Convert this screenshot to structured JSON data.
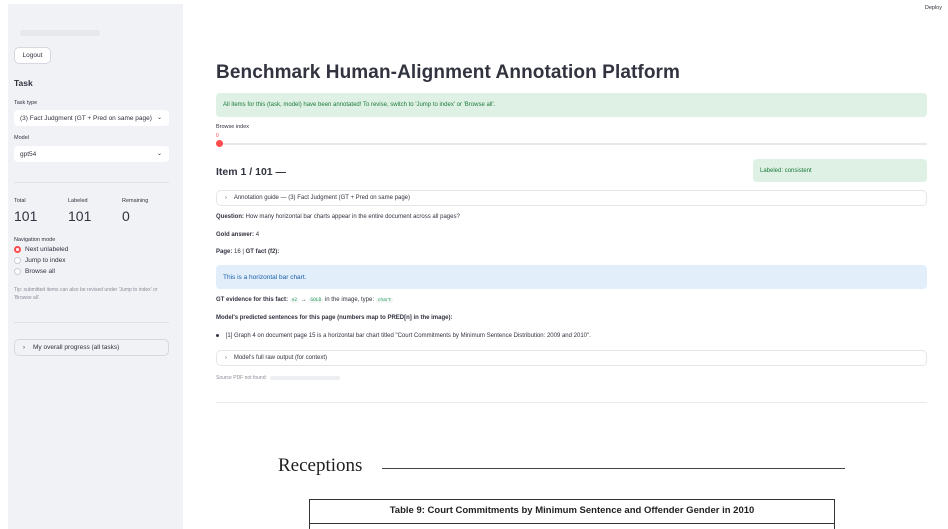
{
  "header": {
    "deploy_label": "Deploy"
  },
  "sidebar": {
    "logout_label": "Logout",
    "task_heading": "Task",
    "task_type_label": "Task type",
    "task_type_value": "(3) Fact Judgment (GT + Pred on same page)",
    "model_label": "Model",
    "model_value": "gpt54",
    "metrics": {
      "total_label": "Total",
      "total_value": "101",
      "labeled_label": "Labeled",
      "labeled_value": "101",
      "remaining_label": "Remaining",
      "remaining_value": "0"
    },
    "navigation_mode_label": "Navigation mode",
    "navigation_options": [
      "Next unlabeled",
      "Jump to index",
      "Browse all"
    ],
    "navigation_selected": "Next unlabeled",
    "tip": "Tip: submitted items can also be revised under 'Jump to index' or 'Browse all'.",
    "progress_expander_label": "My overall progress (all tasks)"
  },
  "main": {
    "title": "Benchmark Human-Alignment Annotation Platform",
    "success_message": "All items for this (task, model) have been annotated! To revise, switch to 'Jump to index' or 'Browse all'.",
    "browse_index_label": "Browse index",
    "browse_index_value": "0",
    "browse_index_max": 100,
    "item_heading": "Item 1 / 101 —",
    "labeled_badge": "Labeled: consistent",
    "annotation_guide_label": "Annotation guide — (3) Fact Judgment (GT + Pred on same page)",
    "question_label": "Question:",
    "question_text": "How many horizontal bar charts appear in the entire document across all pages?",
    "gold_label": "Gold answer:",
    "gold_value": "4",
    "page_label": "Page:",
    "page_value": "16",
    "gt_fact_label": "GT fact (f2):",
    "gt_fact_text": "This is a horizontal bar chart.",
    "gt_evidence_label": "GT evidence for this fact:",
    "gt_evidence_code1": "e2",
    "gt_evidence_arrow": "→",
    "gt_evidence_code2": "GOLD",
    "gt_evidence_mid": "in the image, type:",
    "gt_evidence_type": "chart",
    "predicted_label": "Model's predicted sentences for this page (numbers map to PRED[n] in the image):",
    "predicted_sentences": [
      "[1] Graph 4 on document page 15 is a horizontal bar chart titled \"Court Commitments by Minimum Sentence Distribution: 2009 and 2010\"."
    ],
    "raw_output_label": "Model's full raw output (for context)",
    "source_label": "Source PDF not found:"
  },
  "pdf": {
    "heading": "Receptions",
    "table_title": "Table 9:  Court Commitments by Minimum Sentence and Offender Gender in 2010"
  },
  "colors": {
    "accent": "#ff4b4b",
    "success_bg": "#dff1e4",
    "success_text": "#1b7a3b",
    "info_bg": "#e3eefb",
    "info_text": "#1a5fa8",
    "sidebar_bg": "#f0f2f6"
  }
}
